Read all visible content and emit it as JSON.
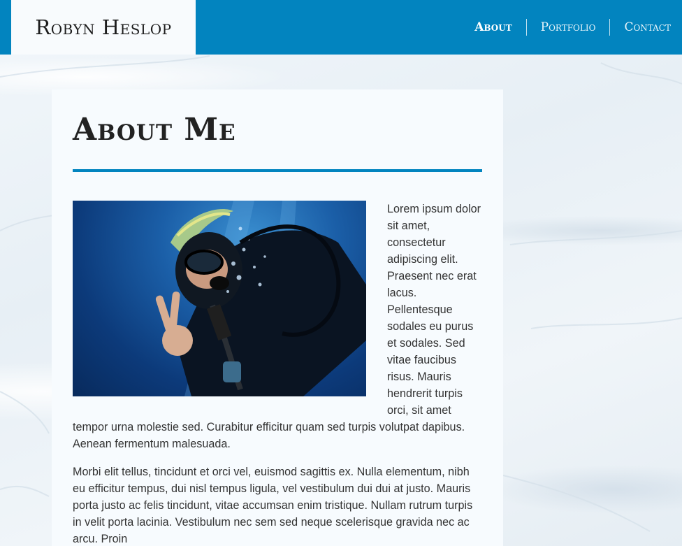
{
  "header": {
    "site_name": "Robyn Heslop",
    "brand_color": "#0284bf",
    "nav": [
      {
        "label": "About",
        "active": true
      },
      {
        "label": "Portfolio",
        "active": false
      },
      {
        "label": "Contact",
        "active": false
      }
    ]
  },
  "main": {
    "title": "About Me",
    "image_icon": "scuba-diver-photo",
    "paragraphs": [
      "Lorem ipsum dolor sit amet, consectetur adipiscing elit. Praesent nec erat lacus. Pellentesque sodales eu purus et sodales. Sed vitae faucibus risus. Mauris hendrerit turpis orci, sit amet tempor urna molestie sed. Curabitur efficitur quam sed turpis volutpat dapibus. Aenean fermentum malesuada.",
      "Morbi elit tellus, tincidunt et orci vel, euismod sagittis ex. Nulla elementum, nibh eu efficitur tempus, dui nisl tempus ligula, vel vestibulum dui dui at justo. Mauris porta justo ac felis tincidunt, vitae accumsan enim tristique. Nullam rutrum turpis in velit porta lacinia. Vestibulum nec sem sed neque scelerisque gravida nec ac arcu. Proin"
    ]
  }
}
